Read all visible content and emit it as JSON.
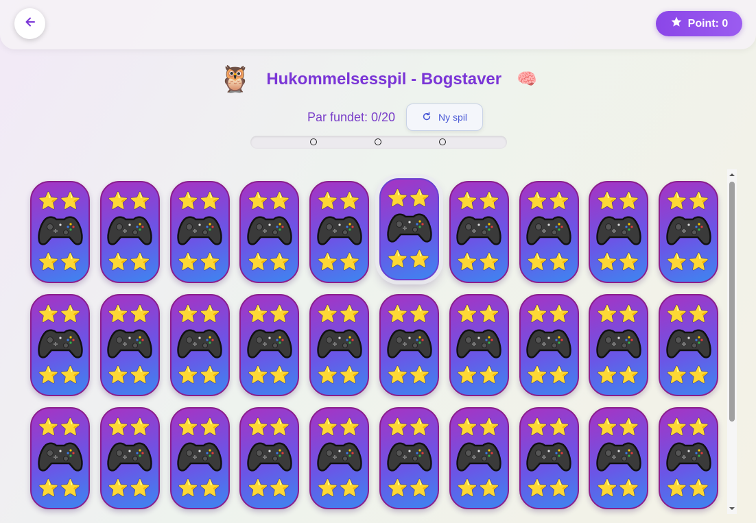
{
  "header": {
    "back_icon": "arrow-left-icon",
    "points_label": "Point: 0",
    "points_icon": "star-icon"
  },
  "title": {
    "text": "Hukommelsesspil - Bogstaver",
    "owl_emoji": "🦉",
    "brain_emoji": "🧠"
  },
  "stats": {
    "pairs_label": "Par fundet: 0/20",
    "new_game_label": "Ny spil",
    "new_game_icon": "refresh-icon"
  },
  "progress": {
    "fraction": 0,
    "markers": 3
  },
  "board": {
    "rows": 3,
    "columns": 10,
    "card_back": {
      "top": "⭐⭐",
      "center_icon": "game-controller-icon",
      "bottom": "⭐⭐"
    },
    "lifted_card": {
      "row": 0,
      "column": 5
    }
  },
  "colors": {
    "accent": "#8b46e8",
    "title": "#7a35d6",
    "card_top": "#a733c2",
    "card_bottom": "#3d86f0"
  }
}
